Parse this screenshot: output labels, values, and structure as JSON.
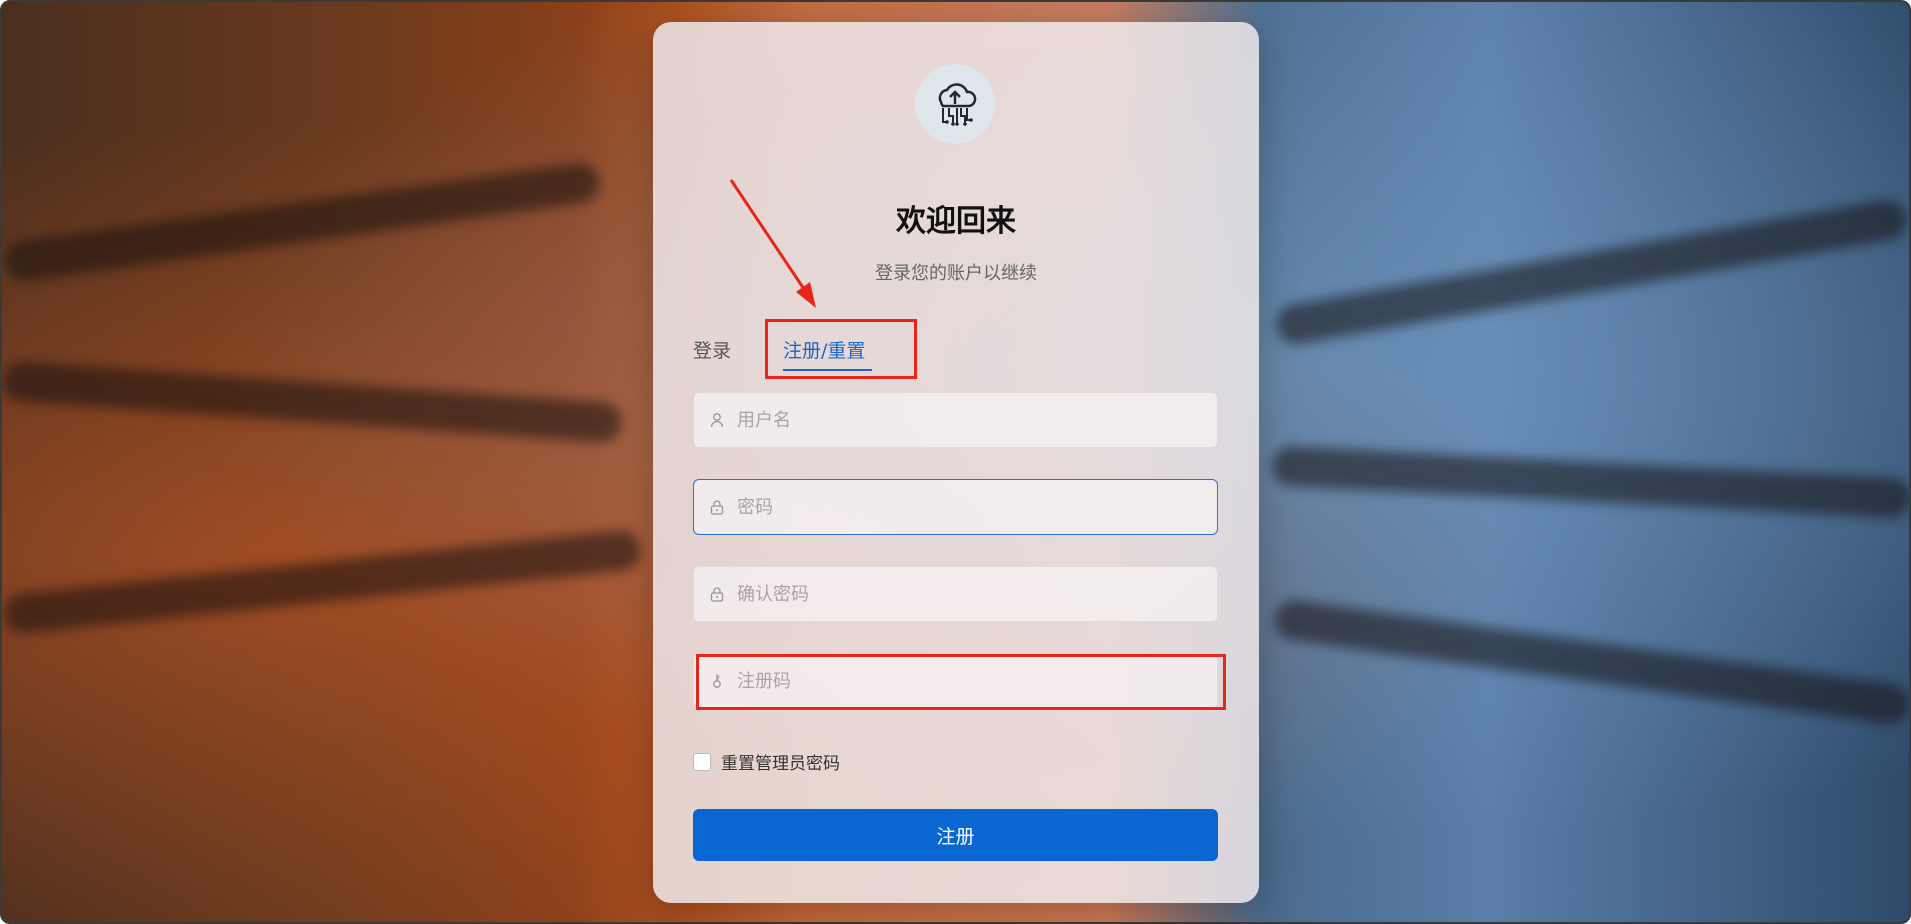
{
  "login": {
    "title": "欢迎回来",
    "subtitle": "登录您的账户以继续",
    "tabs": [
      {
        "label": "登录",
        "active": false
      },
      {
        "label": "注册/重置",
        "active": true
      }
    ],
    "fields": {
      "username": {
        "placeholder": "用户名",
        "value": ""
      },
      "password": {
        "placeholder": "密码",
        "value": ""
      },
      "confirm_password": {
        "placeholder": "确认密码",
        "value": ""
      },
      "register_code": {
        "placeholder": "注册码",
        "value": ""
      }
    },
    "reset_admin_checkbox": {
      "label": "重置管理员密码",
      "checked": false
    },
    "submit_label": "注册"
  },
  "colors": {
    "accent": "#0a66d0",
    "annotation": "#e8241b"
  },
  "icons": [
    "cloud-circuit-logo-icon",
    "user-icon",
    "lock-icon",
    "key-icon"
  ]
}
